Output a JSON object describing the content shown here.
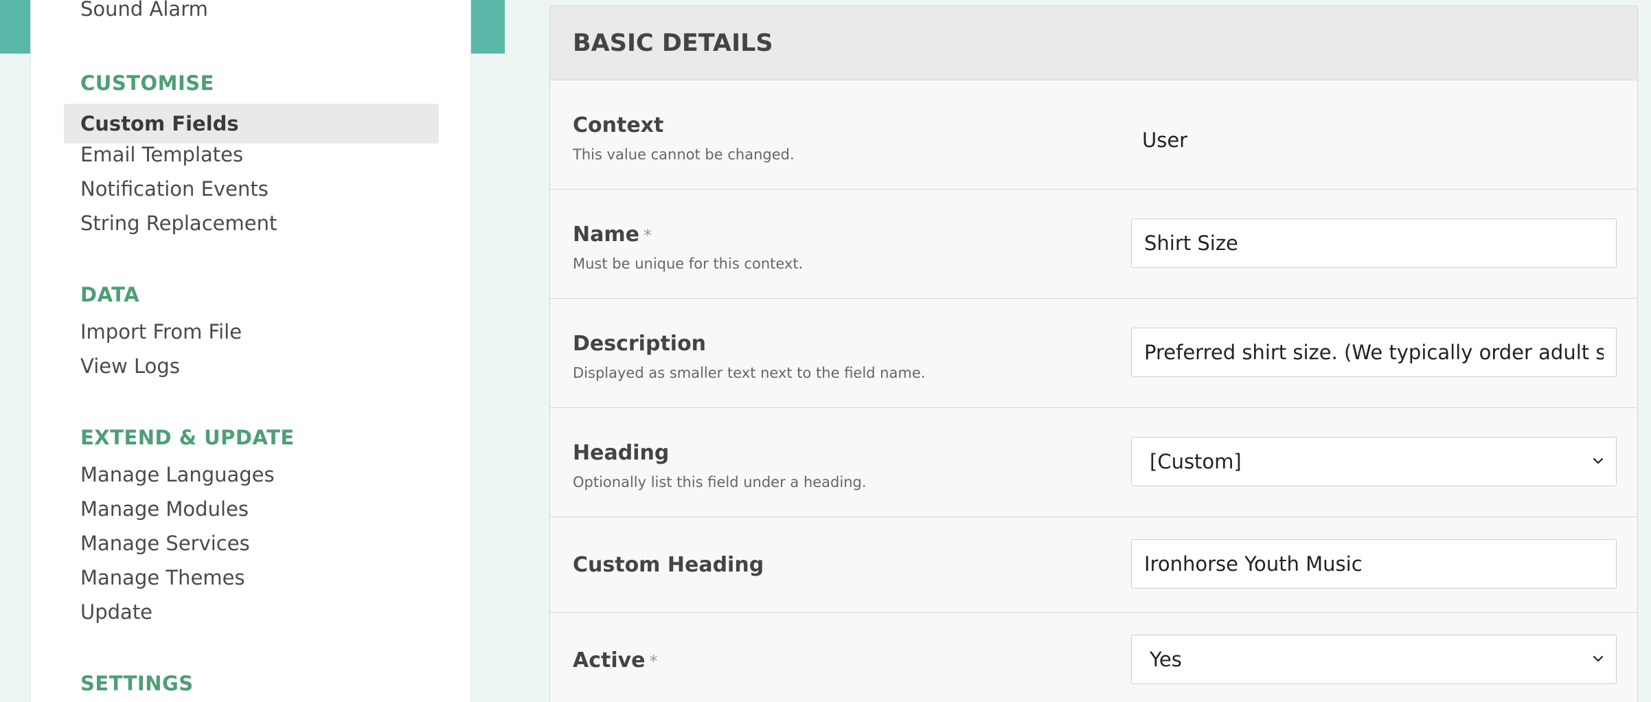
{
  "sidebar": {
    "top_item": "Sound Alarm",
    "sections": [
      {
        "heading": "CUSTOMISE",
        "items": [
          "Custom Fields",
          "Email Templates",
          "Notification Events",
          "String Replacement"
        ]
      },
      {
        "heading": "DATA",
        "items": [
          "Import From File",
          "View Logs"
        ]
      },
      {
        "heading": "EXTEND & UPDATE",
        "items": [
          "Manage Languages",
          "Manage Modules",
          "Manage Services",
          "Manage Themes",
          "Update"
        ]
      },
      {
        "heading": "SETTINGS",
        "items": []
      }
    ],
    "active_item": "Custom Fields"
  },
  "panel": {
    "title": "BASIC DETAILS",
    "fields": {
      "context": {
        "label": "Context",
        "help": "This value cannot be changed.",
        "value": "User"
      },
      "name": {
        "label": "Name",
        "required_mark": "*",
        "help": "Must be unique for this context.",
        "value": "Shirt Size"
      },
      "description": {
        "label": "Description",
        "help": "Displayed as smaller text next to the field name.",
        "value": "Preferred shirt size. (We typically order adult sizes k"
      },
      "heading": {
        "label": "Heading",
        "help": "Optionally list this field under a heading.",
        "value": "[Custom]"
      },
      "custom_heading": {
        "label": "Custom Heading",
        "value": "Ironhorse Youth Music"
      },
      "active": {
        "label": "Active",
        "required_mark": "*",
        "value": "Yes"
      }
    }
  },
  "colors": {
    "teal": "#5bb8a8",
    "section_heading_green": "#4e9f73",
    "active_item_bg": "#e9e9e9"
  }
}
